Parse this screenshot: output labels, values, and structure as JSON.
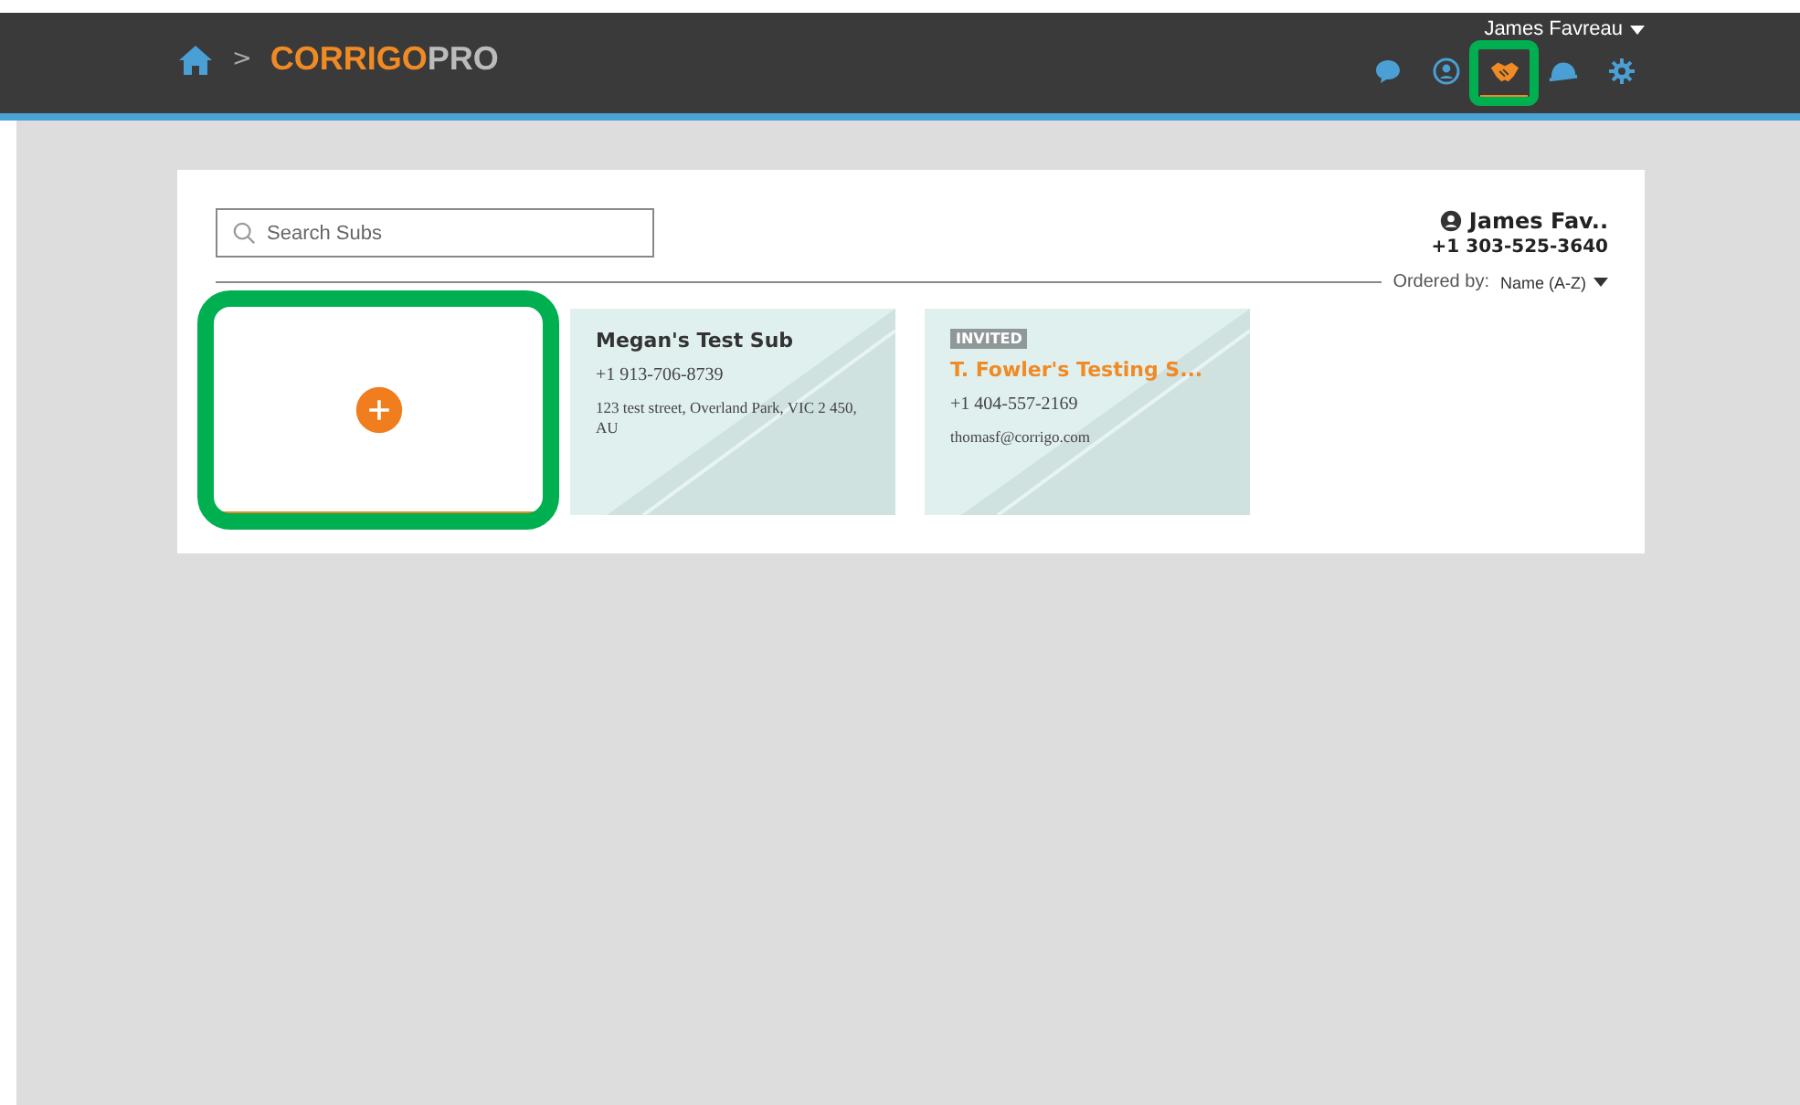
{
  "header": {
    "breadcrumb_separator": ">",
    "brand_main": "CORRIGO",
    "brand_suffix": "PRO",
    "user_menu": "James Favreau",
    "nav_icons": [
      {
        "kind": "chat",
        "selected": false,
        "highlighted": false
      },
      {
        "kind": "user",
        "selected": false,
        "highlighted": false
      },
      {
        "kind": "handshake",
        "selected": true,
        "highlighted": true
      },
      {
        "kind": "helmet",
        "selected": false,
        "highlighted": false
      },
      {
        "kind": "gear",
        "selected": false,
        "highlighted": false
      }
    ]
  },
  "search": {
    "placeholder": "Search Subs"
  },
  "account": {
    "name": "James Fav..",
    "phone": "+1 303-525-3640"
  },
  "sort": {
    "label": "Ordered by:",
    "value": "Name (A-Z)"
  },
  "cards": [
    {
      "kind": "add",
      "highlighted": true
    },
    {
      "kind": "sub",
      "highlighted": false,
      "name": "Megan's Test Sub",
      "lines": [
        "+1 913-706-8739",
        "123 test street, Overland Park, VIC 2 450, AU"
      ]
    },
    {
      "kind": "sub",
      "highlighted": false,
      "badge": "INVITED",
      "name": "T. Fowler's Testing S...",
      "lines": [
        "+1 404-557-2169",
        "thomasf@corrigo.com"
      ]
    }
  ]
}
